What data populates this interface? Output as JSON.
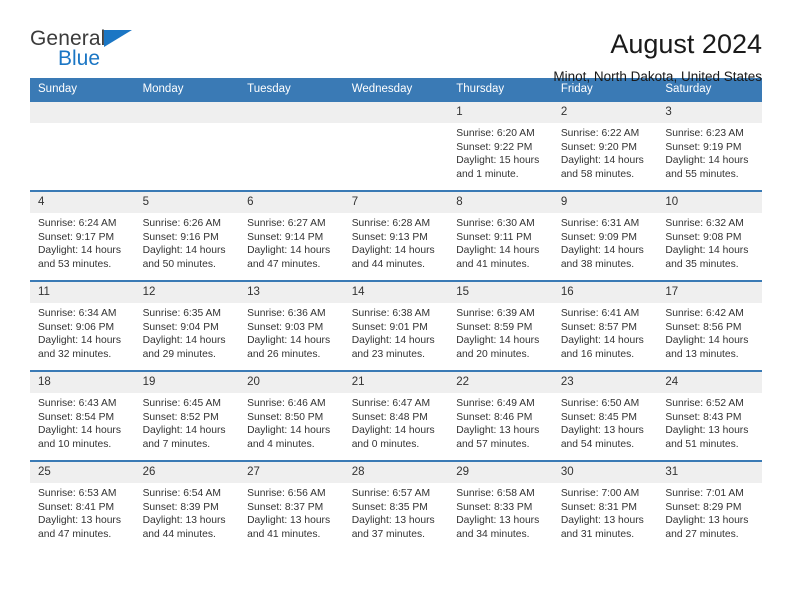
{
  "brand": {
    "name_part1": "General",
    "name_part2": "Blue",
    "accent_color": "#1b76c4"
  },
  "header": {
    "title": "August 2024",
    "subtitle": "Minot, North Dakota, United States"
  },
  "calendar": {
    "header_bg": "#3a7ab5",
    "daynum_bg": "#efefef",
    "weekdays": [
      "Sunday",
      "Monday",
      "Tuesday",
      "Wednesday",
      "Thursday",
      "Friday",
      "Saturday"
    ],
    "labels": {
      "sunrise": "Sunrise:",
      "sunset": "Sunset:",
      "daylight": "Daylight:"
    },
    "weeks": [
      [
        {
          "day": ""
        },
        {
          "day": ""
        },
        {
          "day": ""
        },
        {
          "day": ""
        },
        {
          "day": "1",
          "sunrise": "Sunrise: 6:20 AM",
          "sunset": "Sunset: 9:22 PM",
          "daylight_line1": "Daylight: 15 hours",
          "daylight_line2": "and 1 minute."
        },
        {
          "day": "2",
          "sunrise": "Sunrise: 6:22 AM",
          "sunset": "Sunset: 9:20 PM",
          "daylight_line1": "Daylight: 14 hours",
          "daylight_line2": "and 58 minutes."
        },
        {
          "day": "3",
          "sunrise": "Sunrise: 6:23 AM",
          "sunset": "Sunset: 9:19 PM",
          "daylight_line1": "Daylight: 14 hours",
          "daylight_line2": "and 55 minutes."
        }
      ],
      [
        {
          "day": "4",
          "sunrise": "Sunrise: 6:24 AM",
          "sunset": "Sunset: 9:17 PM",
          "daylight_line1": "Daylight: 14 hours",
          "daylight_line2": "and 53 minutes."
        },
        {
          "day": "5",
          "sunrise": "Sunrise: 6:26 AM",
          "sunset": "Sunset: 9:16 PM",
          "daylight_line1": "Daylight: 14 hours",
          "daylight_line2": "and 50 minutes."
        },
        {
          "day": "6",
          "sunrise": "Sunrise: 6:27 AM",
          "sunset": "Sunset: 9:14 PM",
          "daylight_line1": "Daylight: 14 hours",
          "daylight_line2": "and 47 minutes."
        },
        {
          "day": "7",
          "sunrise": "Sunrise: 6:28 AM",
          "sunset": "Sunset: 9:13 PM",
          "daylight_line1": "Daylight: 14 hours",
          "daylight_line2": "and 44 minutes."
        },
        {
          "day": "8",
          "sunrise": "Sunrise: 6:30 AM",
          "sunset": "Sunset: 9:11 PM",
          "daylight_line1": "Daylight: 14 hours",
          "daylight_line2": "and 41 minutes."
        },
        {
          "day": "9",
          "sunrise": "Sunrise: 6:31 AM",
          "sunset": "Sunset: 9:09 PM",
          "daylight_line1": "Daylight: 14 hours",
          "daylight_line2": "and 38 minutes."
        },
        {
          "day": "10",
          "sunrise": "Sunrise: 6:32 AM",
          "sunset": "Sunset: 9:08 PM",
          "daylight_line1": "Daylight: 14 hours",
          "daylight_line2": "and 35 minutes."
        }
      ],
      [
        {
          "day": "11",
          "sunrise": "Sunrise: 6:34 AM",
          "sunset": "Sunset: 9:06 PM",
          "daylight_line1": "Daylight: 14 hours",
          "daylight_line2": "and 32 minutes."
        },
        {
          "day": "12",
          "sunrise": "Sunrise: 6:35 AM",
          "sunset": "Sunset: 9:04 PM",
          "daylight_line1": "Daylight: 14 hours",
          "daylight_line2": "and 29 minutes."
        },
        {
          "day": "13",
          "sunrise": "Sunrise: 6:36 AM",
          "sunset": "Sunset: 9:03 PM",
          "daylight_line1": "Daylight: 14 hours",
          "daylight_line2": "and 26 minutes."
        },
        {
          "day": "14",
          "sunrise": "Sunrise: 6:38 AM",
          "sunset": "Sunset: 9:01 PM",
          "daylight_line1": "Daylight: 14 hours",
          "daylight_line2": "and 23 minutes."
        },
        {
          "day": "15",
          "sunrise": "Sunrise: 6:39 AM",
          "sunset": "Sunset: 8:59 PM",
          "daylight_line1": "Daylight: 14 hours",
          "daylight_line2": "and 20 minutes."
        },
        {
          "day": "16",
          "sunrise": "Sunrise: 6:41 AM",
          "sunset": "Sunset: 8:57 PM",
          "daylight_line1": "Daylight: 14 hours",
          "daylight_line2": "and 16 minutes."
        },
        {
          "day": "17",
          "sunrise": "Sunrise: 6:42 AM",
          "sunset": "Sunset: 8:56 PM",
          "daylight_line1": "Daylight: 14 hours",
          "daylight_line2": "and 13 minutes."
        }
      ],
      [
        {
          "day": "18",
          "sunrise": "Sunrise: 6:43 AM",
          "sunset": "Sunset: 8:54 PM",
          "daylight_line1": "Daylight: 14 hours",
          "daylight_line2": "and 10 minutes."
        },
        {
          "day": "19",
          "sunrise": "Sunrise: 6:45 AM",
          "sunset": "Sunset: 8:52 PM",
          "daylight_line1": "Daylight: 14 hours",
          "daylight_line2": "and 7 minutes."
        },
        {
          "day": "20",
          "sunrise": "Sunrise: 6:46 AM",
          "sunset": "Sunset: 8:50 PM",
          "daylight_line1": "Daylight: 14 hours",
          "daylight_line2": "and 4 minutes."
        },
        {
          "day": "21",
          "sunrise": "Sunrise: 6:47 AM",
          "sunset": "Sunset: 8:48 PM",
          "daylight_line1": "Daylight: 14 hours",
          "daylight_line2": "and 0 minutes."
        },
        {
          "day": "22",
          "sunrise": "Sunrise: 6:49 AM",
          "sunset": "Sunset: 8:46 PM",
          "daylight_line1": "Daylight: 13 hours",
          "daylight_line2": "and 57 minutes."
        },
        {
          "day": "23",
          "sunrise": "Sunrise: 6:50 AM",
          "sunset": "Sunset: 8:45 PM",
          "daylight_line1": "Daylight: 13 hours",
          "daylight_line2": "and 54 minutes."
        },
        {
          "day": "24",
          "sunrise": "Sunrise: 6:52 AM",
          "sunset": "Sunset: 8:43 PM",
          "daylight_line1": "Daylight: 13 hours",
          "daylight_line2": "and 51 minutes."
        }
      ],
      [
        {
          "day": "25",
          "sunrise": "Sunrise: 6:53 AM",
          "sunset": "Sunset: 8:41 PM",
          "daylight_line1": "Daylight: 13 hours",
          "daylight_line2": "and 47 minutes."
        },
        {
          "day": "26",
          "sunrise": "Sunrise: 6:54 AM",
          "sunset": "Sunset: 8:39 PM",
          "daylight_line1": "Daylight: 13 hours",
          "daylight_line2": "and 44 minutes."
        },
        {
          "day": "27",
          "sunrise": "Sunrise: 6:56 AM",
          "sunset": "Sunset: 8:37 PM",
          "daylight_line1": "Daylight: 13 hours",
          "daylight_line2": "and 41 minutes."
        },
        {
          "day": "28",
          "sunrise": "Sunrise: 6:57 AM",
          "sunset": "Sunset: 8:35 PM",
          "daylight_line1": "Daylight: 13 hours",
          "daylight_line2": "and 37 minutes."
        },
        {
          "day": "29",
          "sunrise": "Sunrise: 6:58 AM",
          "sunset": "Sunset: 8:33 PM",
          "daylight_line1": "Daylight: 13 hours",
          "daylight_line2": "and 34 minutes."
        },
        {
          "day": "30",
          "sunrise": "Sunrise: 7:00 AM",
          "sunset": "Sunset: 8:31 PM",
          "daylight_line1": "Daylight: 13 hours",
          "daylight_line2": "and 31 minutes."
        },
        {
          "day": "31",
          "sunrise": "Sunrise: 7:01 AM",
          "sunset": "Sunset: 8:29 PM",
          "daylight_line1": "Daylight: 13 hours",
          "daylight_line2": "and 27 minutes."
        }
      ]
    ]
  }
}
